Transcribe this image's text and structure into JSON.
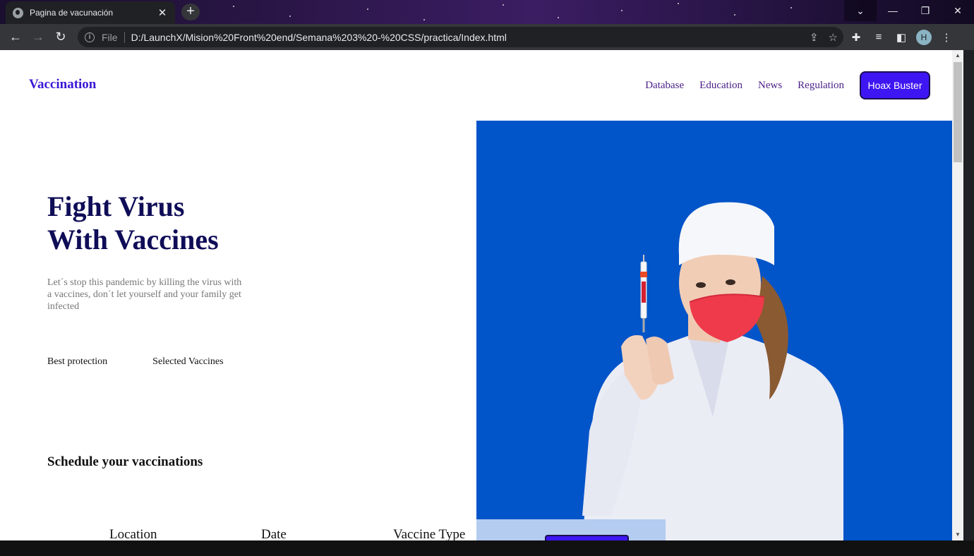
{
  "browser": {
    "tab_title": "Pagina de vacunación",
    "tab_close": "✕",
    "new_tab": "+",
    "file_label": "File",
    "url": "D:/LaunchX/Mision%20Front%20end/Semana%203%20-%20CSS/practica/Index.html",
    "avatar_letter": "H",
    "icons": [
      "globe-icon",
      "back-arrow-icon",
      "forward-arrow-icon",
      "reload-icon",
      "info-icon",
      "share-icon",
      "star-icon",
      "extensions-icon",
      "media-icon",
      "sidepanel-icon",
      "more-icon"
    ]
  },
  "page": {
    "logo": "Vaccination",
    "nav": [
      "Database",
      "Education",
      "News",
      "Regulation"
    ],
    "cta": "Hoax Buster",
    "hero": {
      "title_line1": "Fight Virus",
      "title_line2": "With Vaccines",
      "subtitle": "Let´s stop this pandemic by killing the virus with a vaccines, don´t let yourself and your family get infected"
    },
    "features": [
      "Best protection",
      "Selected Vaccines"
    ],
    "schedule_title": "Schedule your vaccinations",
    "schedule_columns": [
      "Location",
      "Date",
      "Vaccine Type"
    ]
  },
  "colors": {
    "brand": "#3a18d6",
    "cta_bg": "#3d16f3",
    "hero_title": "#0f0d57",
    "hero_panel": "#0254c9"
  }
}
